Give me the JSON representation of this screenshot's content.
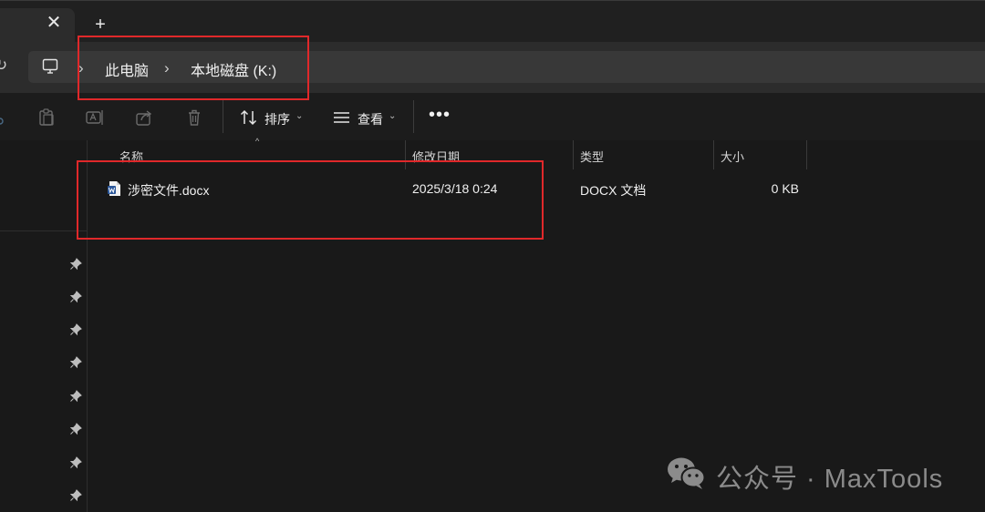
{
  "tabs": {
    "close_glyph": "✕",
    "new_tab_glyph": "+"
  },
  "address": {
    "separator": "›",
    "crumbs": [
      "此电脑",
      "本地磁盘 (K:)"
    ]
  },
  "toolbar": {
    "sort_label": "排序",
    "view_label": "查看",
    "more_glyph": "•••",
    "chevron": "⌄"
  },
  "columns": {
    "name": "名称",
    "modified": "修改日期",
    "type": "类型",
    "size": "大小",
    "sort_indicator": "^"
  },
  "files": [
    {
      "name": "涉密文件.docx",
      "modified": "2025/3/18 0:24",
      "type": "DOCX 文档",
      "size": "0 KB"
    }
  ],
  "watermark": {
    "text": "公众号 · MaxTools"
  },
  "colors": {
    "background": "#191919",
    "highlight": "#e0282a",
    "word_blue": "#2b579a"
  }
}
